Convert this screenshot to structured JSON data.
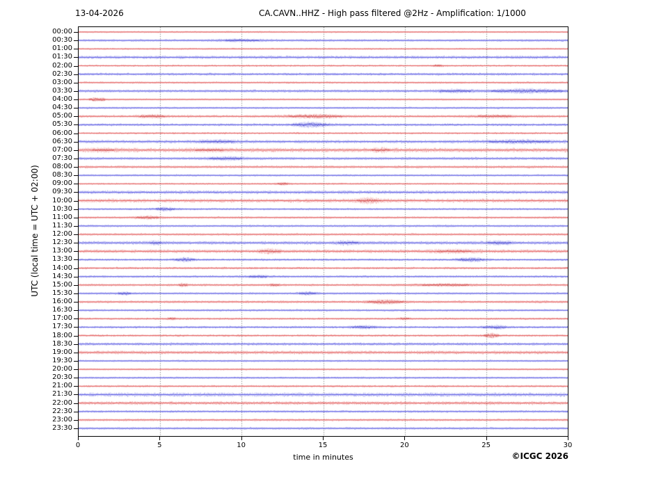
{
  "header": {
    "date": "13-04-2026",
    "title": "CA.CAVN..HHZ - High pass filtered @2Hz - Amplification: 1/1000"
  },
  "footer": {
    "credit": "©ICGC 2026"
  },
  "chart_data": {
    "type": "line",
    "subtype": "helicorder-seismogram",
    "station": "CA.CAVN..HHZ",
    "filter": "High pass filtered @2Hz",
    "amplification": "1/1000",
    "date": "13-04-2026",
    "xlabel": "time in minutes",
    "ylabel": "UTC (local time = UTC + 02:00)",
    "xlim": [
      0,
      30
    ],
    "x_ticks": [
      0,
      5,
      10,
      15,
      20,
      25,
      30
    ],
    "minutes_per_row": 30,
    "grid": "vertical dotted lines every 5 minutes",
    "legend_position": "none",
    "colors": {
      "red": "#e14b4b",
      "red_dark": "#b51f1f",
      "blue": "#4b4be1",
      "blue_dark": "#1f1fb5",
      "grid": "#8a8a8a",
      "frame": "#000000"
    },
    "rows": [
      {
        "time": "00:00",
        "color": "red",
        "noise": 0.8,
        "events": []
      },
      {
        "time": "00:30",
        "color": "blue",
        "noise": 1.2,
        "events": [
          {
            "m": 10,
            "a": 1.2,
            "w": 1.0
          }
        ]
      },
      {
        "time": "01:00",
        "color": "red",
        "noise": 0.8,
        "events": []
      },
      {
        "time": "01:30",
        "color": "blue",
        "noise": 1.7,
        "events": []
      },
      {
        "time": "02:00",
        "color": "red",
        "noise": 0.9,
        "events": [
          {
            "m": 22,
            "a": 1.0,
            "w": 0.3
          }
        ]
      },
      {
        "time": "02:30",
        "color": "blue",
        "noise": 1.4,
        "events": []
      },
      {
        "time": "03:00",
        "color": "red",
        "noise": 1.0,
        "events": []
      },
      {
        "time": "03:30",
        "color": "blue",
        "noise": 1.5,
        "events": [
          {
            "m": 23,
            "a": 1.3,
            "w": 0.8
          },
          {
            "m": 27.5,
            "a": 2.0,
            "w": 1.5
          }
        ]
      },
      {
        "time": "04:00",
        "color": "red",
        "noise": 0.9,
        "events": [
          {
            "m": 0.9,
            "a": 2.2,
            "w": 0.18
          },
          {
            "m": 1.4,
            "a": 2.0,
            "w": 0.15
          }
        ]
      },
      {
        "time": "04:30",
        "color": "blue",
        "noise": 1.0,
        "events": []
      },
      {
        "time": "05:00",
        "color": "red",
        "noise": 1.3,
        "events": [
          {
            "m": 4.5,
            "a": 1.6,
            "w": 0.6
          },
          {
            "m": 14.5,
            "a": 1.8,
            "w": 1.2
          },
          {
            "m": 25.5,
            "a": 1.2,
            "w": 1.0
          }
        ]
      },
      {
        "time": "05:30",
        "color": "blue",
        "noise": 1.4,
        "events": [
          {
            "m": 14.2,
            "a": 2.8,
            "w": 0.7
          }
        ]
      },
      {
        "time": "06:00",
        "color": "red",
        "noise": 1.0,
        "events": []
      },
      {
        "time": "06:30",
        "color": "blue",
        "noise": 1.7,
        "events": [
          {
            "m": 8.5,
            "a": 1.2,
            "w": 1.0
          },
          {
            "m": 27,
            "a": 1.5,
            "w": 1.5
          }
        ]
      },
      {
        "time": "07:00",
        "color": "red",
        "noise": 2.3,
        "events": [
          {
            "m": 1.5,
            "a": 1.0,
            "w": 0.8
          },
          {
            "m": 8,
            "a": 1.0,
            "w": 1.0
          },
          {
            "m": 18.5,
            "a": 1.3,
            "w": 0.5
          }
        ]
      },
      {
        "time": "07:30",
        "color": "blue",
        "noise": 1.5,
        "events": [
          {
            "m": 9,
            "a": 1.5,
            "w": 0.8
          }
        ]
      },
      {
        "time": "08:00",
        "color": "red",
        "noise": 1.4,
        "events": []
      },
      {
        "time": "08:30",
        "color": "blue",
        "noise": 1.0,
        "events": []
      },
      {
        "time": "09:00",
        "color": "red",
        "noise": 0.9,
        "events": [
          {
            "m": 12.5,
            "a": 1.3,
            "w": 0.3
          }
        ]
      },
      {
        "time": "09:30",
        "color": "blue",
        "noise": 1.9,
        "events": []
      },
      {
        "time": "10:00",
        "color": "red",
        "noise": 2.1,
        "events": [
          {
            "m": 17.8,
            "a": 2.2,
            "w": 0.5
          }
        ]
      },
      {
        "time": "10:30",
        "color": "blue",
        "noise": 1.0,
        "events": [
          {
            "m": 5.3,
            "a": 2.0,
            "w": 0.4
          }
        ]
      },
      {
        "time": "11:00",
        "color": "red",
        "noise": 1.1,
        "events": [
          {
            "m": 4.2,
            "a": 1.8,
            "w": 0.5
          }
        ]
      },
      {
        "time": "11:30",
        "color": "blue",
        "noise": 1.2,
        "events": []
      },
      {
        "time": "12:00",
        "color": "red",
        "noise": 1.2,
        "events": []
      },
      {
        "time": "12:30",
        "color": "blue",
        "noise": 1.9,
        "events": [
          {
            "m": 4.7,
            "a": 1.5,
            "w": 0.3
          },
          {
            "m": 16.5,
            "a": 1.5,
            "w": 0.5
          },
          {
            "m": 25.8,
            "a": 1.5,
            "w": 0.6
          }
        ]
      },
      {
        "time": "13:00",
        "color": "red",
        "noise": 1.9,
        "events": [
          {
            "m": 11.7,
            "a": 1.8,
            "w": 0.5
          },
          {
            "m": 23,
            "a": 1.2,
            "w": 1.0
          }
        ]
      },
      {
        "time": "13:30",
        "color": "blue",
        "noise": 1.2,
        "events": [
          {
            "m": 6.5,
            "a": 2.2,
            "w": 0.4
          },
          {
            "m": 24,
            "a": 2.0,
            "w": 0.6
          }
        ]
      },
      {
        "time": "14:00",
        "color": "red",
        "noise": 1.2,
        "events": []
      },
      {
        "time": "14:30",
        "color": "blue",
        "noise": 1.2,
        "events": [
          {
            "m": 11,
            "a": 1.3,
            "w": 0.5
          }
        ]
      },
      {
        "time": "15:00",
        "color": "red",
        "noise": 1.2,
        "events": [
          {
            "m": 6.4,
            "a": 1.6,
            "w": 0.2
          },
          {
            "m": 12,
            "a": 1.0,
            "w": 0.3
          },
          {
            "m": 22.5,
            "a": 1.1,
            "w": 1.5
          }
        ]
      },
      {
        "time": "15:30",
        "color": "blue",
        "noise": 1.1,
        "events": [
          {
            "m": 2.8,
            "a": 1.5,
            "w": 0.3
          },
          {
            "m": 14,
            "a": 1.6,
            "w": 0.4
          }
        ]
      },
      {
        "time": "16:00",
        "color": "red",
        "noise": 1.3,
        "events": [
          {
            "m": 18.8,
            "a": 2.5,
            "w": 0.7
          }
        ]
      },
      {
        "time": "16:30",
        "color": "blue",
        "noise": 1.1,
        "events": []
      },
      {
        "time": "17:00",
        "color": "red",
        "noise": 1.0,
        "events": [
          {
            "m": 5.7,
            "a": 1.3,
            "w": 0.2
          },
          {
            "m": 20,
            "a": 1.0,
            "w": 0.3
          }
        ]
      },
      {
        "time": "17:30",
        "color": "blue",
        "noise": 1.2,
        "events": [
          {
            "m": 17.5,
            "a": 1.6,
            "w": 0.6
          },
          {
            "m": 25.5,
            "a": 2.0,
            "w": 0.5
          }
        ]
      },
      {
        "time": "18:00",
        "color": "red",
        "noise": 1.1,
        "events": [
          {
            "m": 25.3,
            "a": 2.8,
            "w": 0.3
          }
        ]
      },
      {
        "time": "18:30",
        "color": "blue",
        "noise": 1.6,
        "events": []
      },
      {
        "time": "19:00",
        "color": "red",
        "noise": 1.9,
        "events": []
      },
      {
        "time": "19:30",
        "color": "blue",
        "noise": 1.0,
        "events": []
      },
      {
        "time": "20:00",
        "color": "red",
        "noise": 0.9,
        "events": []
      },
      {
        "time": "20:30",
        "color": "blue",
        "noise": 1.0,
        "events": []
      },
      {
        "time": "21:00",
        "color": "red",
        "noise": 1.1,
        "events": []
      },
      {
        "time": "21:30",
        "color": "blue",
        "noise": 2.2,
        "events": []
      },
      {
        "time": "22:00",
        "color": "red",
        "noise": 1.9,
        "events": []
      },
      {
        "time": "22:30",
        "color": "blue",
        "noise": 1.2,
        "events": []
      },
      {
        "time": "23:00",
        "color": "red",
        "noise": 1.2,
        "events": []
      },
      {
        "time": "23:30",
        "color": "blue",
        "noise": 1.2,
        "events": []
      }
    ]
  }
}
